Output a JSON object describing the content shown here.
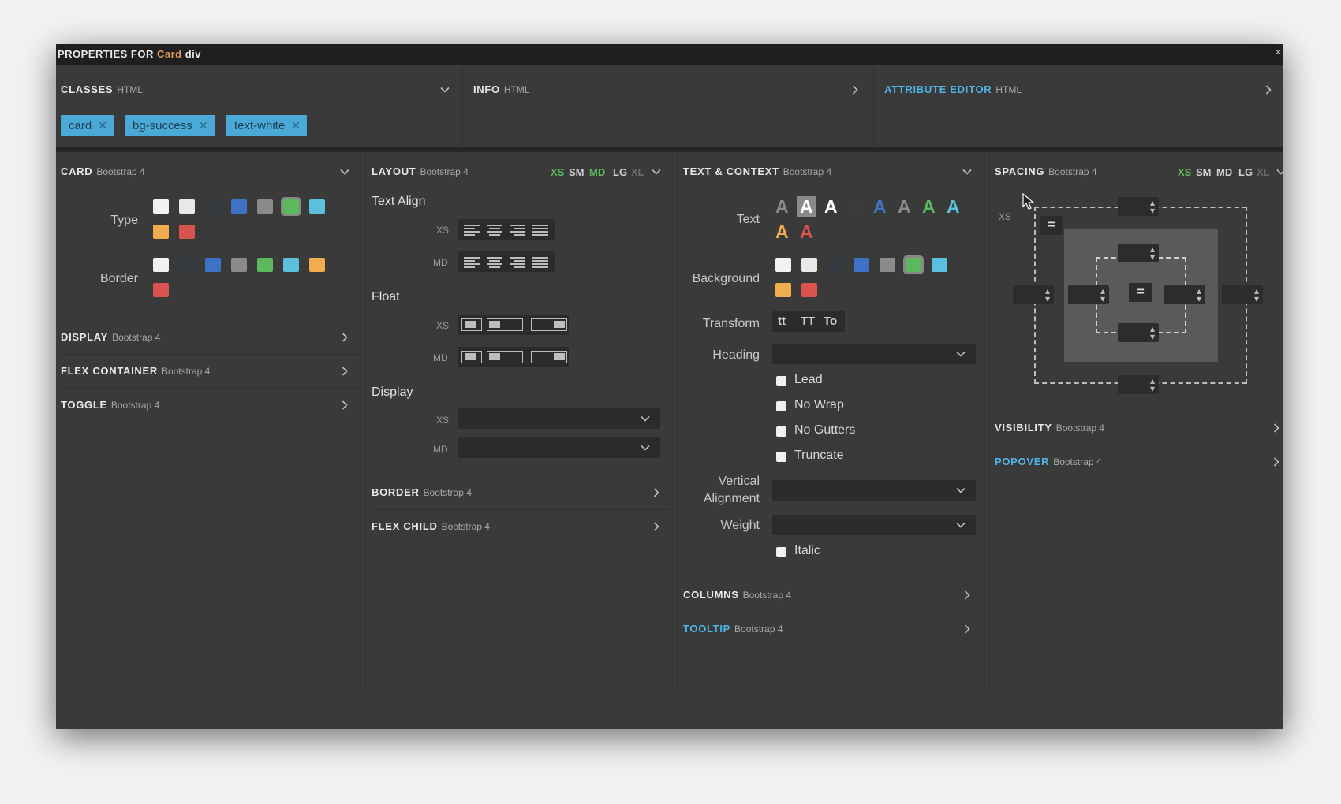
{
  "titlebar": {
    "prefix": "PROPERTIES FOR",
    "element_class": "Card",
    "element_tag": "div",
    "close": "×"
  },
  "classes": {
    "title": "CLASSES",
    "sub": "HTML",
    "tags": [
      "card",
      "bg-success",
      "text-white"
    ],
    "remove_glyph": "✕"
  },
  "info": {
    "title": "INFO",
    "sub": "HTML"
  },
  "attribute_editor": {
    "title": "ATTRIBUTE EDITOR",
    "sub": "HTML"
  },
  "card": {
    "title": "CARD",
    "sub": "Bootstrap 4",
    "type_label": "Type",
    "border_label": "Border",
    "type_colors": [
      "#f2f2f2",
      "#e8e8e8",
      "#343a40",
      "#3d72c4",
      "#8a8a8a",
      "#5cb85c",
      "#5bc0de",
      "#f0ad4e",
      "#d9534f"
    ],
    "border_colors": [
      "#f2f2f2",
      "#343a40",
      "#3d72c4",
      "#8a8a8a",
      "#5cb85c",
      "#5bc0de",
      "#f0ad4e",
      "#d9534f"
    ]
  },
  "display_sec": {
    "title": "DISPLAY",
    "sub": "Bootstrap 4"
  },
  "flex_container": {
    "title": "FLEX CONTAINER",
    "sub": "Bootstrap 4"
  },
  "toggle": {
    "title": "TOGGLE",
    "sub": "Bootstrap 4"
  },
  "layout": {
    "title": "LAYOUT",
    "sub": "Bootstrap 4",
    "breakpoints": [
      "XS",
      "SM",
      "MD",
      "LG",
      "XL"
    ],
    "text_align": "Text Align",
    "float": "Float",
    "display": "Display",
    "xs": "XS",
    "md": "MD"
  },
  "border_sec": {
    "title": "BORDER",
    "sub": "Bootstrap 4"
  },
  "flex_child": {
    "title": "FLEX CHILD",
    "sub": "Bootstrap 4"
  },
  "text_context": {
    "title": "TEXT & CONTEXT",
    "sub": "Bootstrap 4",
    "text_label": "Text",
    "background_label": "Background",
    "transform_label": "Transform",
    "heading_label": "Heading",
    "vertical_label_1": "Vertical",
    "vertical_label_2": "Alignment",
    "weight_label": "Weight",
    "glyph": "A",
    "text_colors": [
      "#8a8a8a",
      "#ffffff",
      "#ffffff",
      "#3d3d3d",
      "#3d72c4",
      "#8a8a8a",
      "#5cb85c",
      "#5bc0de",
      "#f0ad4e",
      "#d9534f"
    ],
    "bg_colors": [
      "#f2f2f2",
      "#e8e8e8",
      "#343a40",
      "#3d72c4",
      "#8a8a8a",
      "#5cb85c",
      "#5bc0de",
      "#f0ad4e",
      "#d9534f"
    ],
    "transforms": [
      "tt",
      "TT",
      "To"
    ],
    "checks": [
      "Lead",
      "No Wrap",
      "No Gutters",
      "Truncate"
    ],
    "italic": "Italic"
  },
  "columns": {
    "title": "COLUMNS",
    "sub": "Bootstrap 4"
  },
  "tooltip": {
    "title": "TOOLTIP",
    "sub": "Bootstrap 4"
  },
  "spacing": {
    "title": "SPACING",
    "sub": "Bootstrap 4",
    "breakpoints": [
      "XS",
      "SM",
      "MD",
      "LG",
      "XL"
    ],
    "xs": "XS",
    "equal": "="
  },
  "visibility": {
    "title": "VISIBILITY",
    "sub": "Bootstrap 4"
  },
  "popover": {
    "title": "POPOVER",
    "sub": "Bootstrap 4"
  }
}
